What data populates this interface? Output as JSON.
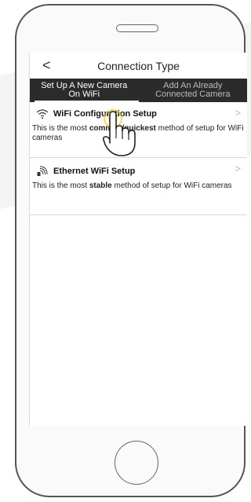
{
  "header": {
    "back_icon": "chevron-left-icon",
    "back_glyph": "<",
    "title": "Connection Type"
  },
  "tabs": [
    {
      "line1": "Set Up A New Camera",
      "line2": "On WiFi",
      "active": true
    },
    {
      "line1": "Add An Already",
      "line2": "Connected Camera",
      "active": false
    }
  ],
  "options": [
    {
      "icon": "wifi-icon",
      "title": "WiFi Configuration Setup",
      "desc_before": "This is the most ",
      "desc_bold": "common/quickest",
      "desc_after": " method of setup for WiFi cameras",
      "chevron": ">"
    },
    {
      "icon": "ethernet-wifi-icon",
      "title": "Ethernet WiFi Setup",
      "desc_before": "This is the most ",
      "desc_bold": "stable",
      "desc_after": " method of setup for WiFi cameras",
      "chevron": ">"
    }
  ],
  "overlay": {
    "pointer_icon": "tap-hand-icon",
    "accent": "#f2c200"
  }
}
